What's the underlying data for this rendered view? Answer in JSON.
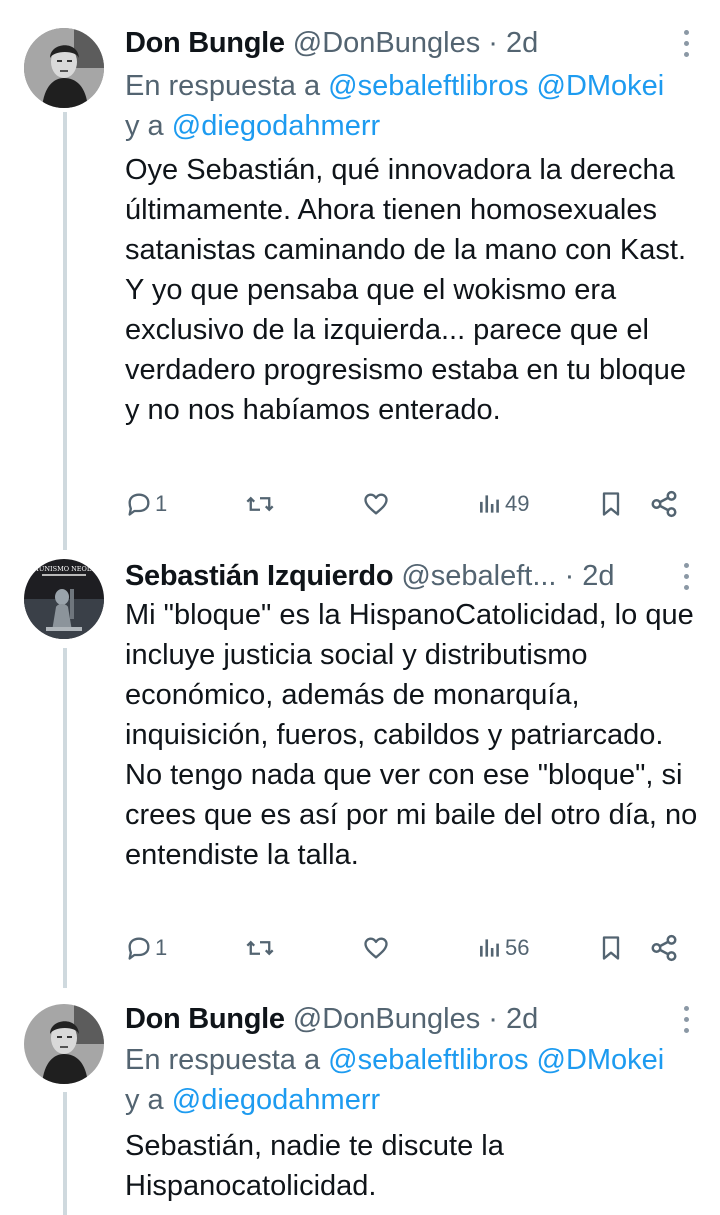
{
  "tweets": [
    {
      "author_name": "Don Bungle",
      "handle": "@DonBungles",
      "separator": "·",
      "time": "2d",
      "reply_prefix": "En respuesta a",
      "reply_mentions": [
        "@sebaleftlibros",
        "@DMokei"
      ],
      "reply_conjunction": "y a",
      "reply_last_mention": "@diegodahmerr",
      "text_lines": [
        "Oye Sebastián, qué innovadora la derecha últimamente. Ahora tienen homosexuales satanistas caminando de la mano con Kast. Y yo que pensaba que el wokismo era exclusivo de la izquierda... parece que el verdadero progresismo estaba en tu bloque y no nos habíamos enterado."
      ],
      "replies": "1",
      "retweets": "",
      "likes": "",
      "views": "49",
      "icons": [
        "reply-icon",
        "retweet-icon",
        "like-icon",
        "views-icon",
        "bookmark-icon",
        "share-icon"
      ]
    },
    {
      "author_name": "Sebastián Izquierdo",
      "handle": "@sebaleft...",
      "separator": "·",
      "time": "2d",
      "text_lines": [
        "Mi \"bloque\" es la HispanoCatolicidad, lo que incluye justicia social y distributismo económico, además de monarquía, inquisición, fueros, cabildos y patriarcado.",
        "No tengo nada que ver con ese \"bloque\", si crees que es así por mi baile del otro día, no entendiste la talla."
      ],
      "replies": "1",
      "retweets": "",
      "likes": "",
      "views": "56",
      "avatar_text": "EL COMUNISMO NEOLIBERAL"
    },
    {
      "author_name": "Don Bungle",
      "handle": "@DonBungles",
      "separator": "·",
      "time": "2d",
      "reply_prefix": "En respuesta a",
      "reply_mentions": [
        "@sebaleftlibros",
        "@DMokei"
      ],
      "reply_conjunction": "y a",
      "reply_last_mention": "@diegodahmerr",
      "text_lines": [
        "Sebastián, nadie te discute la Hispanocatolicidad."
      ]
    }
  ],
  "colors": {
    "accent": "#1d9bf0",
    "secondary_text": "#536471",
    "thread_line": "#cfd9de"
  }
}
